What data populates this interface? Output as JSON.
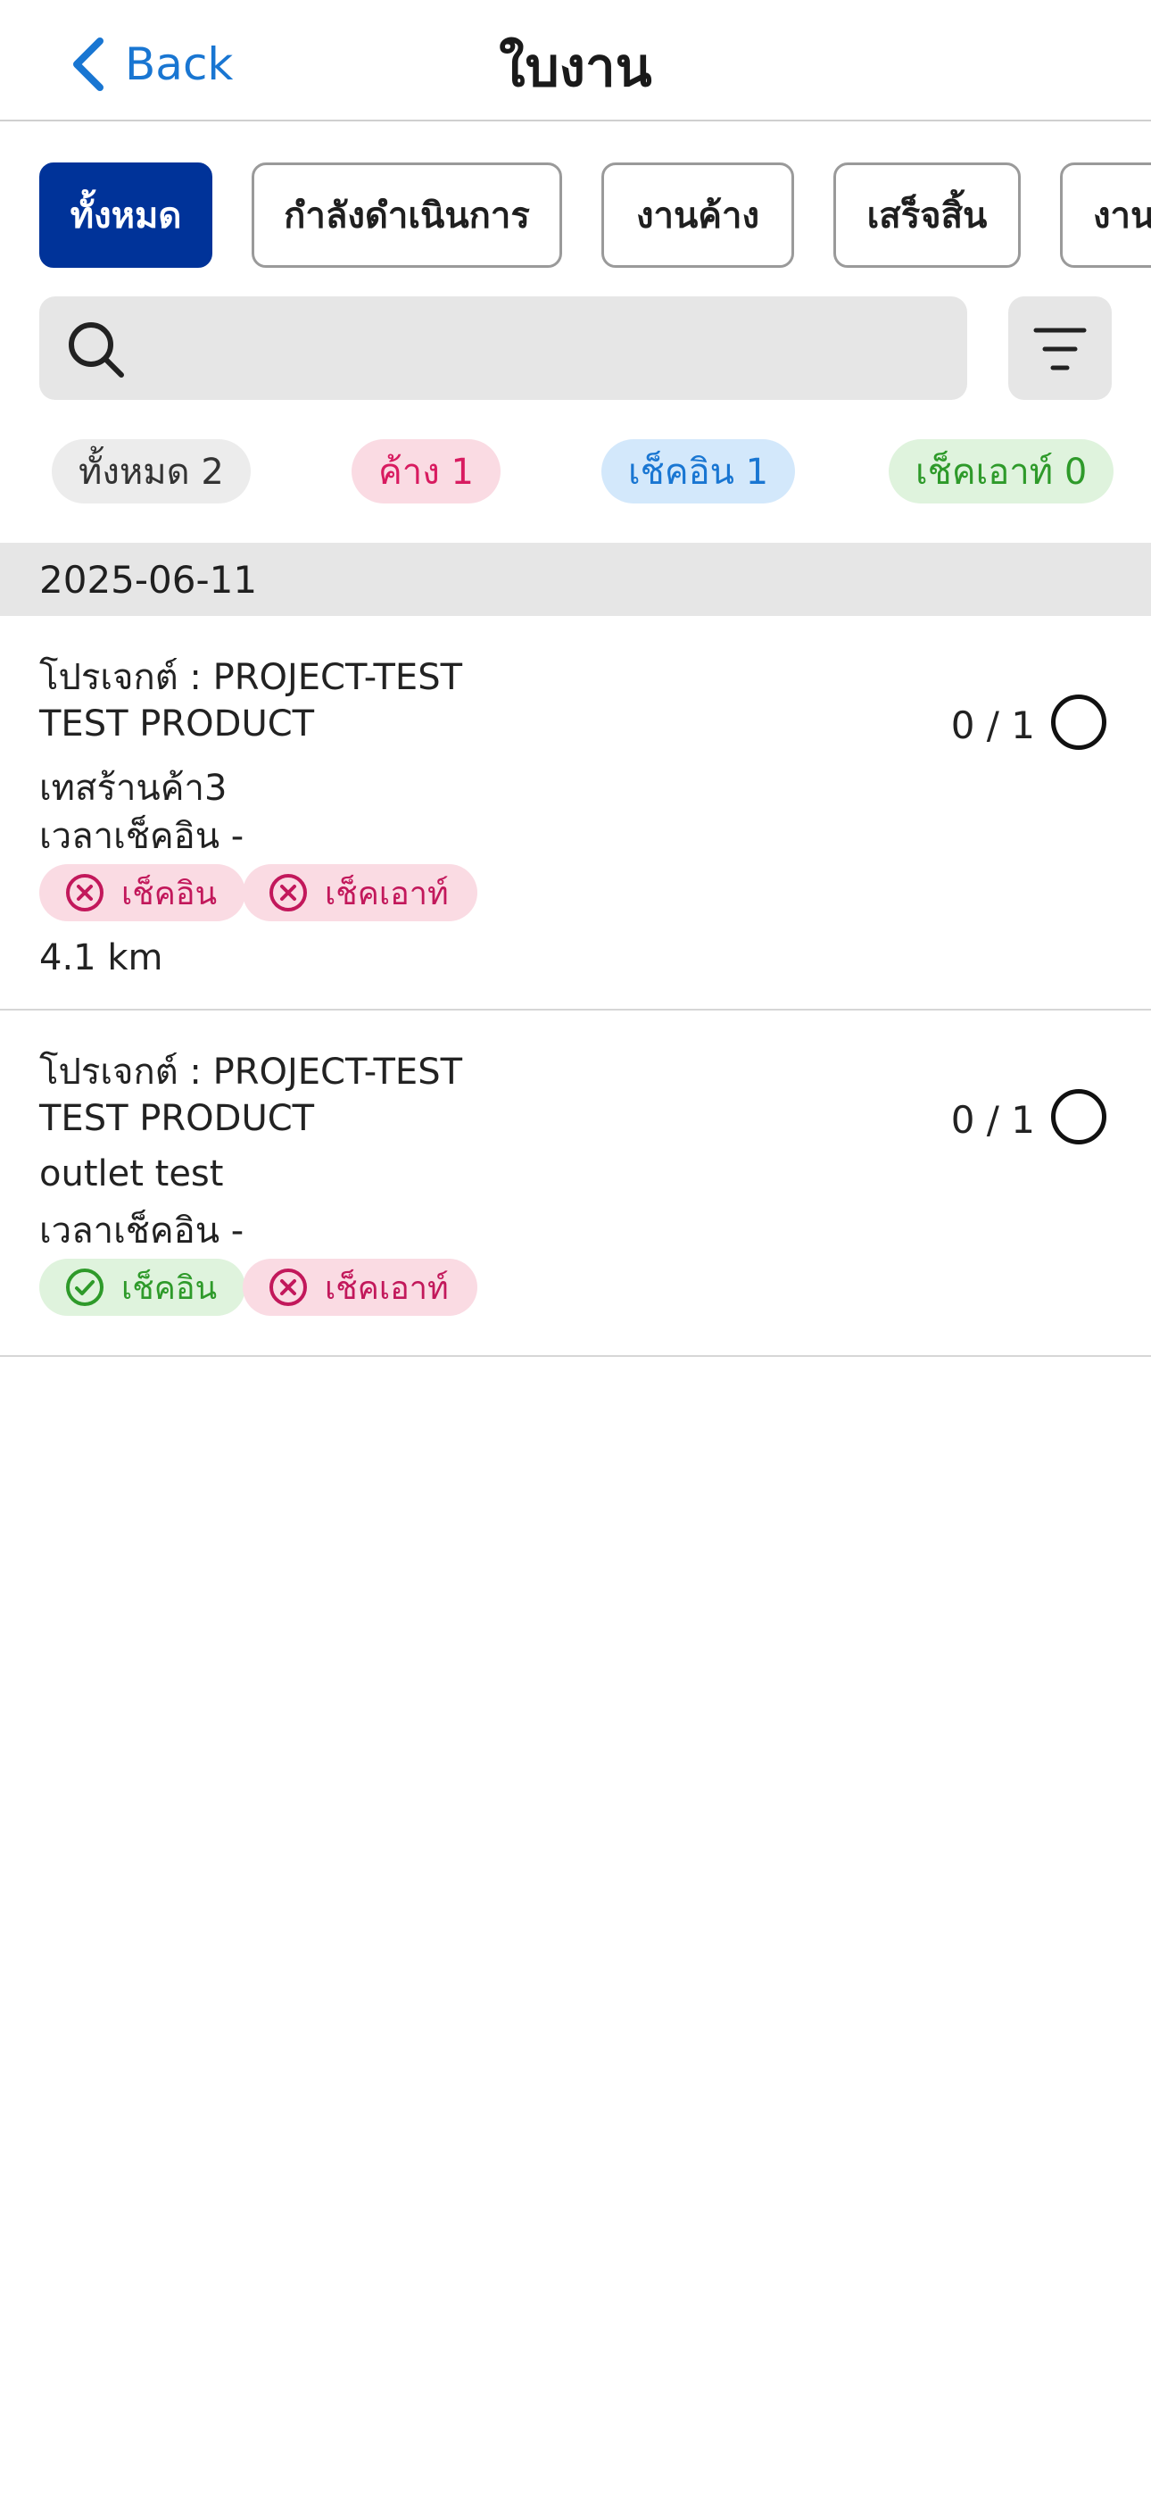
{
  "header": {
    "back_label": "Back",
    "title": "ใบงาน"
  },
  "tabs": [
    {
      "label": "ทั้งหมด",
      "active": true
    },
    {
      "label": "กำลังดำเนินการ",
      "active": false
    },
    {
      "label": "งานค้าง",
      "active": false
    },
    {
      "label": "เสร็จสิ้น",
      "active": false
    },
    {
      "label": "งาน",
      "active": false
    }
  ],
  "search": {
    "value": "",
    "placeholder": ""
  },
  "counts": {
    "all": "ทั้งหมด 2",
    "pending": "ค้าง 1",
    "checkin": "เช็คอิน 1",
    "checkout": "เช็คเอาท์ 0"
  },
  "date_group": "2025-06-11",
  "jobs": [
    {
      "project": "โปรเจกต์ : PROJECT-TEST",
      "product": "TEST PRODUCT",
      "outlet": "เทสร้านค้า3",
      "checkin_time": "เวลาเช็คอิน -",
      "progress": "0 / 1",
      "checkin_tag": {
        "label": "เช็คอิน",
        "status": "not-done"
      },
      "checkout_tag": {
        "label": "เช็คเอาท์",
        "status": "not-done"
      },
      "distance": "4.1 km"
    },
    {
      "project": "โปรเจกต์ : PROJECT-TEST",
      "product": "TEST PRODUCT",
      "outlet": "outlet test",
      "checkin_time": "เวลาเช็คอิน -",
      "progress": "0 / 1",
      "checkin_tag": {
        "label": "เช็คอิน",
        "status": "done"
      },
      "checkout_tag": {
        "label": "เช็คเอาท์",
        "status": "not-done"
      }
    }
  ],
  "colors": {
    "accent": "#1976d2",
    "tab_active": "#003399",
    "tag_negative": "#c2185b",
    "tag_positive": "#2e9a2a"
  }
}
